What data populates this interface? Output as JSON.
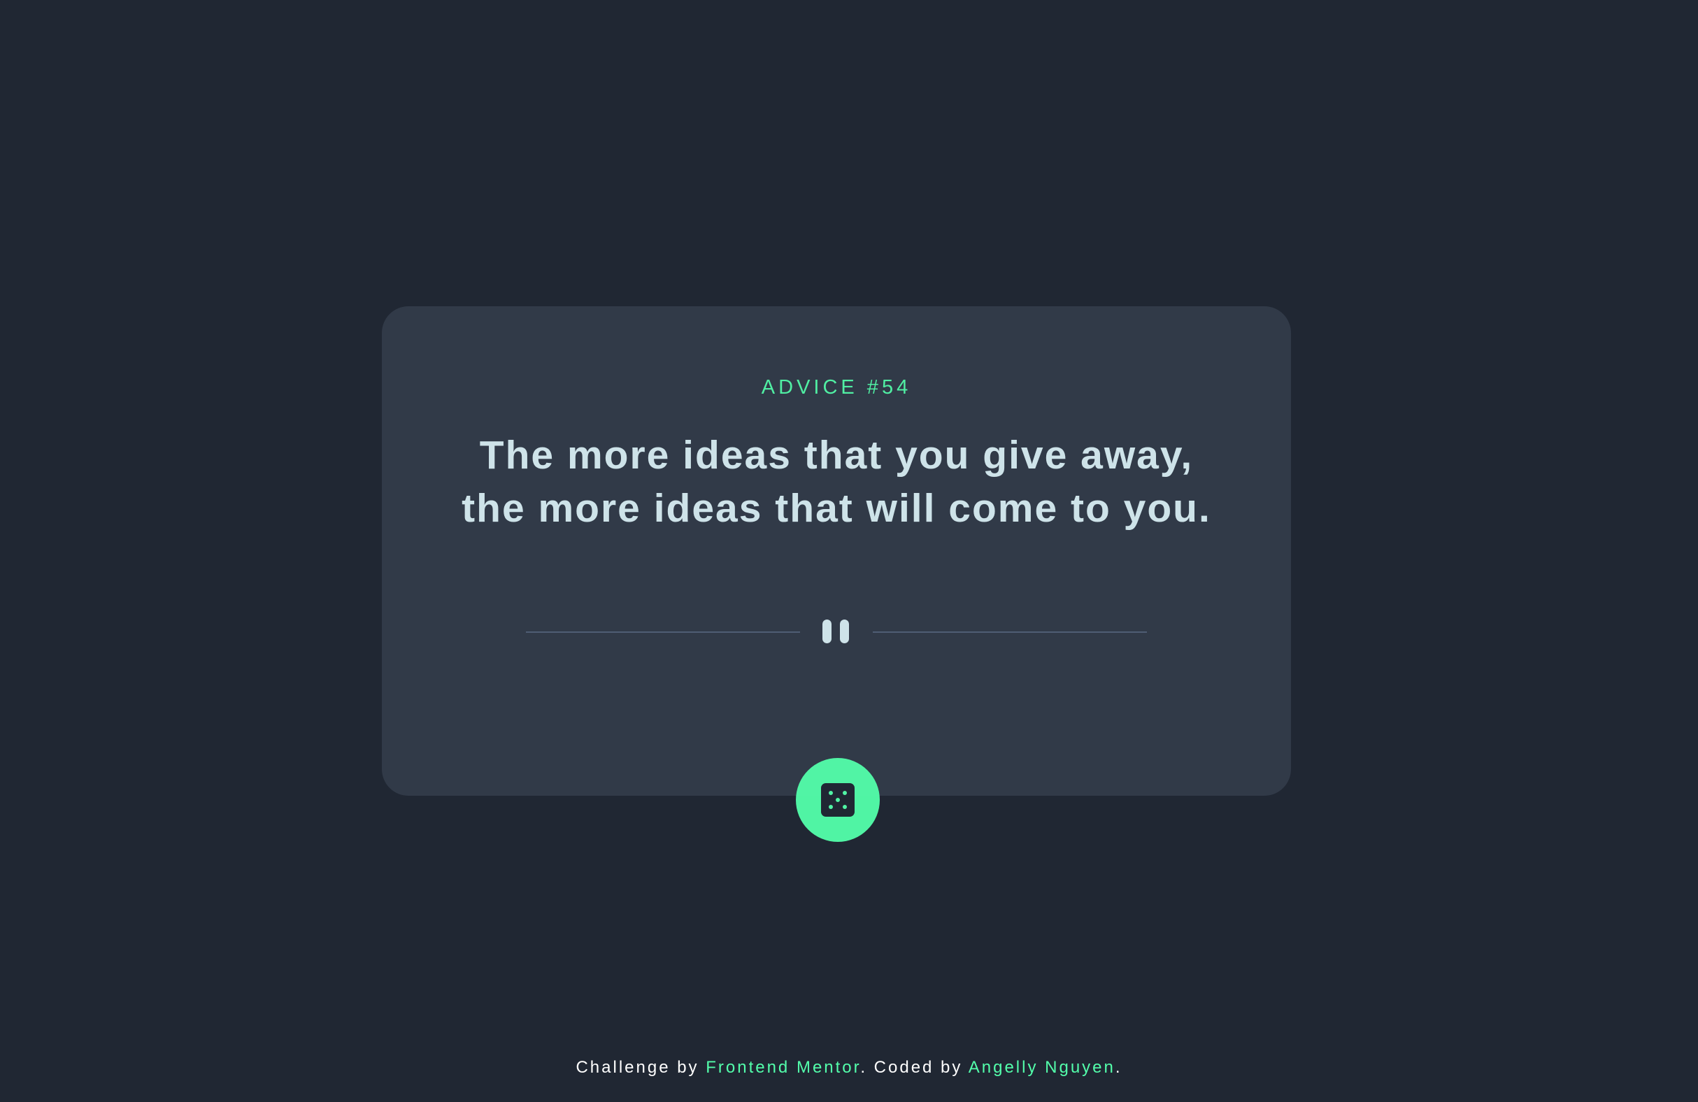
{
  "card": {
    "advice_label": "ADVICE #54",
    "advice_text": "The more ideas that you give away, the more ideas that will come to you."
  },
  "divider": {
    "icon": "pause-icon"
  },
  "dice_button": {
    "icon": "dice-icon",
    "color": "#53ffab"
  },
  "attribution": {
    "prefix": "Challenge by ",
    "challenge_link": "Frontend Mentor",
    "middle": ". Coded by ",
    "author_link": "Angelly Nguyen",
    "suffix": "."
  },
  "colors": {
    "background": "#202733",
    "card": "#313a48",
    "accent": "#53ffab",
    "quote_text": "#cee3e9",
    "divider": "#4f5d74"
  }
}
